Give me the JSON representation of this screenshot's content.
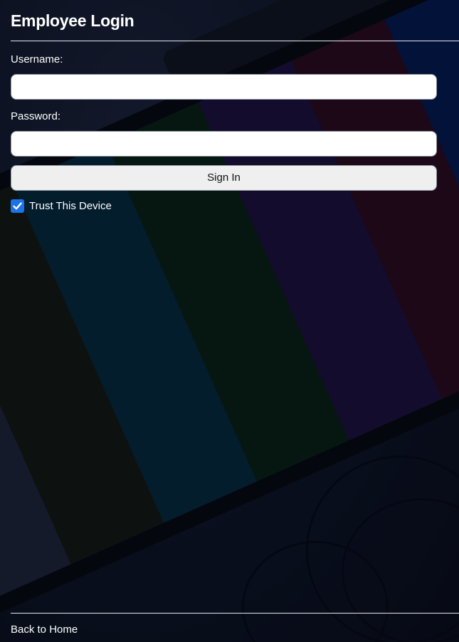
{
  "page": {
    "title": "Employee Login"
  },
  "form": {
    "username_label": "Username:",
    "username_value": "",
    "password_label": "Password:",
    "password_value": "",
    "submit_label": "Sign In",
    "trust_label": "Trust This Device",
    "trust_checked": true
  },
  "footer": {
    "back_link": "Back to Home"
  },
  "colors": {
    "background": "#0b1220",
    "text": "#ffffff",
    "checkbox_accent": "#1a73e8",
    "button_bg": "#efefef"
  }
}
